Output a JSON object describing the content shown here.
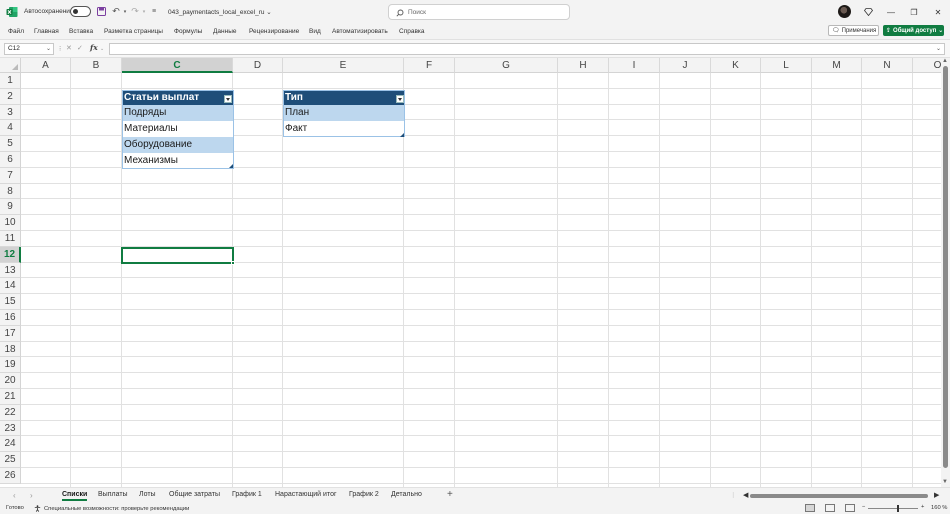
{
  "titlebar": {
    "autosave_label": "Автосохранение",
    "filename": "043_paymentacts_local_excel_ru",
    "search_placeholder": "Поиск",
    "minimize": "—",
    "restore": "❐",
    "close": "✕"
  },
  "menu": {
    "items": [
      "Файл",
      "Главная",
      "Вставка",
      "Разметка страницы",
      "Формулы",
      "Данные",
      "Рецензирование",
      "Вид",
      "Автоматизировать",
      "Справка"
    ],
    "comments_label": "Примечания",
    "share_label": "Общий доступ"
  },
  "formula_bar": {
    "name_box": "C12",
    "fx_label": "fx",
    "formula": ""
  },
  "grid": {
    "columns": [
      "A",
      "B",
      "C",
      "D",
      "E",
      "F",
      "G",
      "H",
      "I",
      "J",
      "K",
      "L",
      "M",
      "N",
      "O"
    ],
    "rows": [
      "1",
      "2",
      "3",
      "4",
      "5",
      "6",
      "7",
      "8",
      "9",
      "10",
      "11",
      "12",
      "13",
      "14",
      "15",
      "16",
      "17",
      "18",
      "19",
      "20",
      "21",
      "22",
      "23",
      "24",
      "25",
      "26"
    ],
    "selected_column": "C",
    "selected_row": "12"
  },
  "tables": {
    "payments": {
      "header": "Статьи выплат",
      "rows": [
        "Подряды",
        "Материалы",
        "Оборудование",
        "Механизмы"
      ]
    },
    "types": {
      "header": "Тип",
      "rows": [
        "План",
        "Факт"
      ]
    }
  },
  "sheets": {
    "tabs": [
      "Списки",
      "Выплаты",
      "Лоты",
      "Общие затраты",
      "График 1",
      "Нарастающий итог",
      "График 2",
      "Детально"
    ],
    "active": "Списки",
    "add_label": "+"
  },
  "status": {
    "ready": "Готово",
    "accessibility": "Специальные возможности: проверьте рекомендации",
    "zoom_minus": "−",
    "zoom_plus": "+",
    "zoom": "160 %"
  },
  "colors": {
    "accent": "#107c41",
    "table_header": "#1f4e79",
    "table_band": "#bdd7ee"
  }
}
